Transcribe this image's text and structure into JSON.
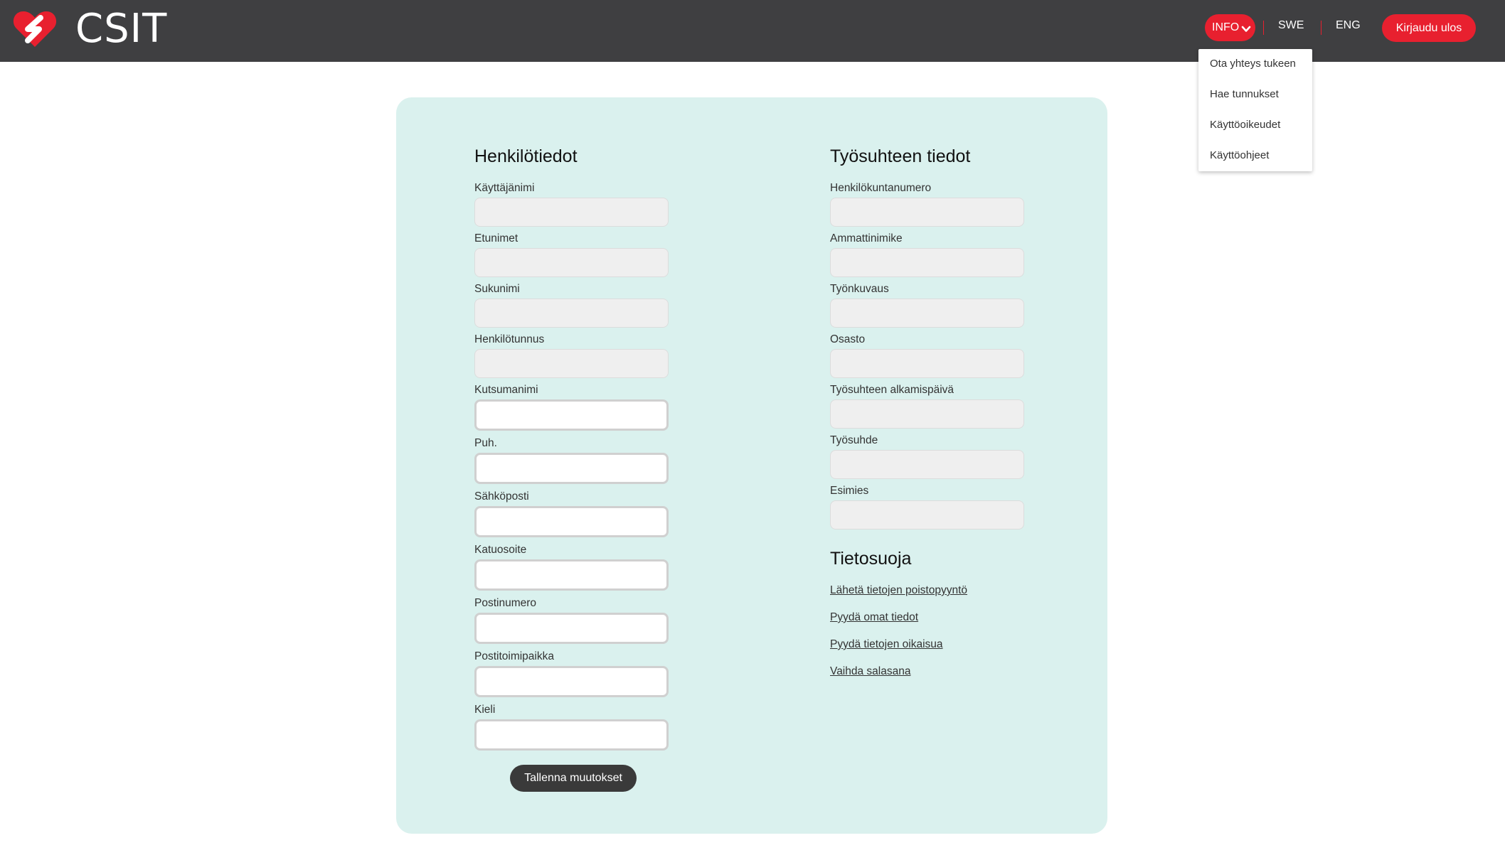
{
  "header": {
    "brand": "CSIT",
    "nav": {
      "info_label": "INFO",
      "swe_label": "SWE",
      "eng_label": "ENG",
      "logout_label": "Kirjaudu ulos"
    },
    "accent_color": "#e8202f",
    "bar_color": "#3f3f41"
  },
  "info_dropdown": {
    "items": [
      "Ota yhteys tukeen",
      "Hae tunnukset",
      "Käyttöoikeudet",
      "Käyttöohjeet"
    ]
  },
  "personal": {
    "title": "Henkilötiedot",
    "readonly_fields": [
      "Käyttäjänimi",
      "Etunimet",
      "Sukunimi",
      "Henkilötunnus"
    ],
    "editable_fields": [
      "Kutsumanimi",
      "Puh.",
      "Sähköposti",
      "Katuosoite",
      "Postinumero",
      "Postitoimipaikka",
      "Kieli"
    ],
    "save_label": "Tallenna muutokset"
  },
  "employment": {
    "title": "Työsuhteen tiedot",
    "readonly_fields": [
      "Henkilökuntanumero",
      "Ammattinimike",
      "Työnkuvaus",
      "Osasto",
      "Työsuhteen alkamispäivä",
      "Työsuhde",
      "Esimies"
    ]
  },
  "privacy": {
    "title": "Tietosuoja",
    "links": [
      "Lähetä tietojen poistopyyntö",
      "Pyydä omat tiedot",
      "Pyydä tietojen oikaisua",
      "Vaihda salasana"
    ]
  },
  "card_color": "#daf1ee"
}
